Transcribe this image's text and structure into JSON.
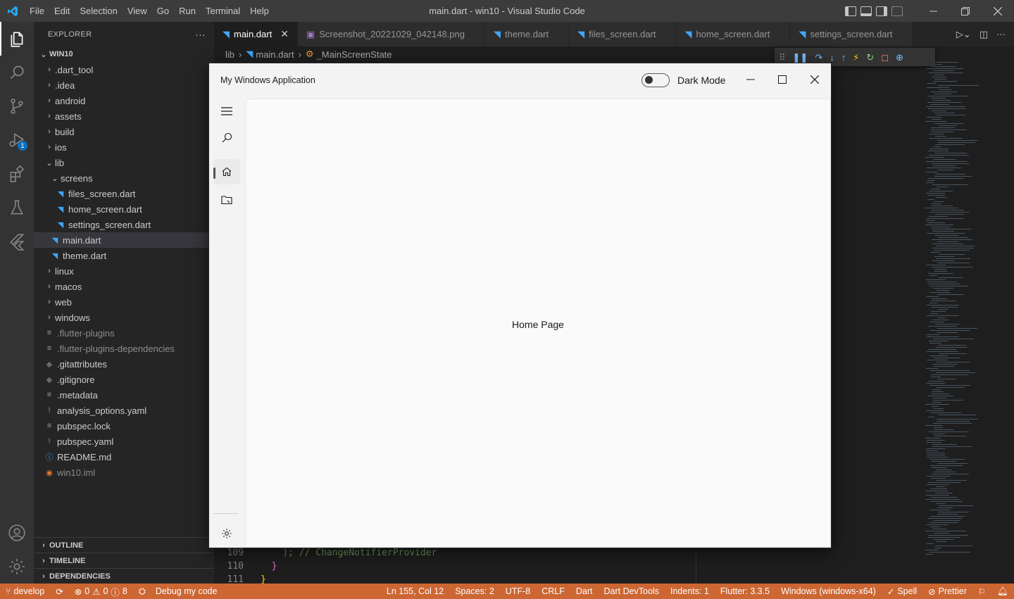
{
  "titlebar": {
    "menu": [
      "File",
      "Edit",
      "Selection",
      "View",
      "Go",
      "Run",
      "Terminal",
      "Help"
    ],
    "title": "main.dart - win10 - Visual Studio Code"
  },
  "activity": {
    "debug_badge": "1"
  },
  "sidebar": {
    "header": "EXPLORER",
    "more": "···",
    "root": "WIN10",
    "tree": [
      {
        "label": "dart_tool",
        "prefix": ".",
        "kind": "folder",
        "depth": 0
      },
      {
        "label": ".idea",
        "kind": "folder",
        "depth": 0
      },
      {
        "label": "android",
        "kind": "folder",
        "depth": 0
      },
      {
        "label": "assets",
        "kind": "folder",
        "depth": 0
      },
      {
        "label": "build",
        "kind": "folder",
        "depth": 0
      },
      {
        "label": "ios",
        "kind": "folder",
        "depth": 0
      },
      {
        "label": "lib",
        "kind": "folder-open",
        "depth": 0
      },
      {
        "label": "screens",
        "kind": "folder-open",
        "depth": 1
      },
      {
        "label": "files_screen.dart",
        "kind": "dart",
        "depth": 2
      },
      {
        "label": "home_screen.dart",
        "kind": "dart",
        "depth": 2
      },
      {
        "label": "settings_screen.dart",
        "kind": "dart",
        "depth": 2
      },
      {
        "label": "main.dart",
        "kind": "dart",
        "depth": 1,
        "selected": true
      },
      {
        "label": "theme.dart",
        "kind": "dart",
        "depth": 1
      },
      {
        "label": "linux",
        "kind": "folder",
        "depth": 0
      },
      {
        "label": "macos",
        "kind": "folder",
        "depth": 0
      },
      {
        "label": "web",
        "kind": "folder",
        "depth": 0
      },
      {
        "label": "windows",
        "kind": "folder",
        "depth": 0
      },
      {
        "label": ".flutter-plugins",
        "kind": "lines",
        "depth": 0,
        "dim": true
      },
      {
        "label": ".flutter-plugins-dependencies",
        "kind": "lines",
        "depth": 0,
        "dim": true
      },
      {
        "label": ".gitattributes",
        "kind": "git",
        "depth": 0
      },
      {
        "label": ".gitignore",
        "kind": "git",
        "depth": 0
      },
      {
        "label": ".metadata",
        "kind": "lines",
        "depth": 0
      },
      {
        "label": "analysis_options.yaml",
        "kind": "yaml",
        "depth": 0
      },
      {
        "label": "pubspec.lock",
        "kind": "lines",
        "depth": 0
      },
      {
        "label": "pubspec.yaml",
        "kind": "yaml",
        "depth": 0
      },
      {
        "label": "README.md",
        "kind": "info",
        "depth": 0
      },
      {
        "label": "win10.iml",
        "kind": "rss",
        "depth": 0,
        "dim": true
      }
    ],
    "outline": "OUTLINE",
    "timeline": "TIMELINE",
    "dependencies": "DEPENDENCIES"
  },
  "tabs": [
    {
      "label": "main.dart",
      "active": true,
      "icon": "dart"
    },
    {
      "label": "Screenshot_20221029_042148.png",
      "active": false,
      "icon": "image"
    },
    {
      "label": "theme.dart",
      "active": false,
      "icon": "dart"
    },
    {
      "label": "files_screen.dart",
      "active": false,
      "icon": "dart"
    },
    {
      "label": "home_screen.dart",
      "active": false,
      "icon": "dart"
    },
    {
      "label": "settings_screen.dart",
      "active": false,
      "icon": "dart"
    }
  ],
  "breadcrumb": {
    "folder": "lib",
    "file": "main.dart",
    "symbol": "_MainScreenState"
  },
  "code": [
    {
      "line": "109",
      "text": "    ); // ChangeNotifierProvider"
    },
    {
      "line": "110",
      "text": "  }"
    },
    {
      "line": "111",
      "text": "}"
    }
  ],
  "app": {
    "title": "My Windows Application",
    "dark_mode_label": "Dark Mode",
    "dark_mode_on": false,
    "content_text": "Home Page"
  },
  "statusbar": {
    "branch": "develop",
    "errors": "0",
    "warnings": "0",
    "info": "8",
    "debug": "Debug my code",
    "position": "Ln 155, Col 12",
    "spaces": "Spaces: 2",
    "encoding": "UTF-8",
    "eol": "CRLF",
    "language": "Dart",
    "devtools": "Dart DevTools",
    "indents": "Indents: 1",
    "flutter": "Flutter: 3.3.5",
    "device": "Windows (windows-x64)",
    "spell": "Spell",
    "prettier": "Prettier"
  },
  "colors": {
    "statusbar": "#cc6633",
    "accent": "#0e70c0",
    "dart": "#42a5f5"
  }
}
